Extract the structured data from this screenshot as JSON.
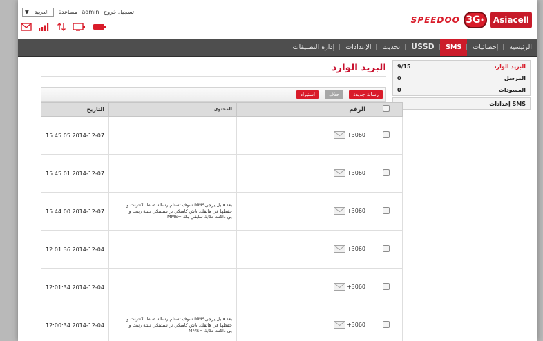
{
  "header": {
    "language": "العربية",
    "help": "مساعدة",
    "user": "admin",
    "logout": "تسجيل خروج",
    "speedoo": "SPEEDOO",
    "badge": "3G",
    "badge_sup": "+",
    "brand": "Asiacell"
  },
  "status_icons": [
    "mail-icon",
    "signal-icon",
    "transfer-icon",
    "device-icon",
    "battery-icon"
  ],
  "nav": {
    "items": [
      {
        "label": "الرئيسية",
        "active": false
      },
      {
        "label": "إحصائيات",
        "active": false
      },
      {
        "label": "SMS",
        "active": true
      },
      {
        "label": "USSD",
        "active": false
      },
      {
        "label": "تحديث",
        "active": false
      },
      {
        "label": "الإعدادات",
        "active": false
      },
      {
        "label": "إدارة التطبيقات",
        "active": false
      }
    ]
  },
  "sidebar": {
    "rows": [
      {
        "label": "البريد الوارد",
        "count": "9/15",
        "active": true
      },
      {
        "label": "المرسل",
        "count": "0",
        "active": false
      },
      {
        "label": "المسودات",
        "count": "0",
        "active": false
      }
    ],
    "settings": "إعدادات SMS"
  },
  "main": {
    "title": "البريد الوارد",
    "buttons": {
      "new_message": "رسالة جديدة",
      "delete": "حذف",
      "import": "استيراد"
    },
    "columns": {
      "number": "الرقم",
      "content": "المحتوى",
      "date": "التاريخ"
    },
    "rows": [
      {
        "number": "+3060",
        "content": "",
        "date": "15:45:05 2014-12-07"
      },
      {
        "number": "+3060",
        "content": "",
        "date": "15:45:01 2014-12-07"
      },
      {
        "number": "+3060",
        "content": "سوف تستلم رسالة ضبط الانترنت و MMSبعد قليل,يرجى حفظها في هاتفك. باش كاميكي نر سيتبنكي نينتة رنيت و MMS= بي داكتت نكاية سابقي بكة",
        "date": "15:44:00 2014-12-07"
      },
      {
        "number": "+3060",
        "content": "",
        "date": "12:01:36 2014-12-04"
      },
      {
        "number": "+3060",
        "content": "",
        "date": "12:01:34 2014-12-04"
      },
      {
        "number": "+3060",
        "content": "سوف تستلم رسالة ضبط الانترنت و MMSبعد قليل,يرجى حفظها في هاتفك. باش كاميكي نر سيتبنكي نينتة رنيت و MMS= بي داكتت نكاية",
        "date": "12:00:34 2014-12-04"
      }
    ]
  },
  "colors": {
    "accent": "#d91c2a",
    "nav_bg": "#4e4e4e",
    "title": "#c8102e"
  }
}
